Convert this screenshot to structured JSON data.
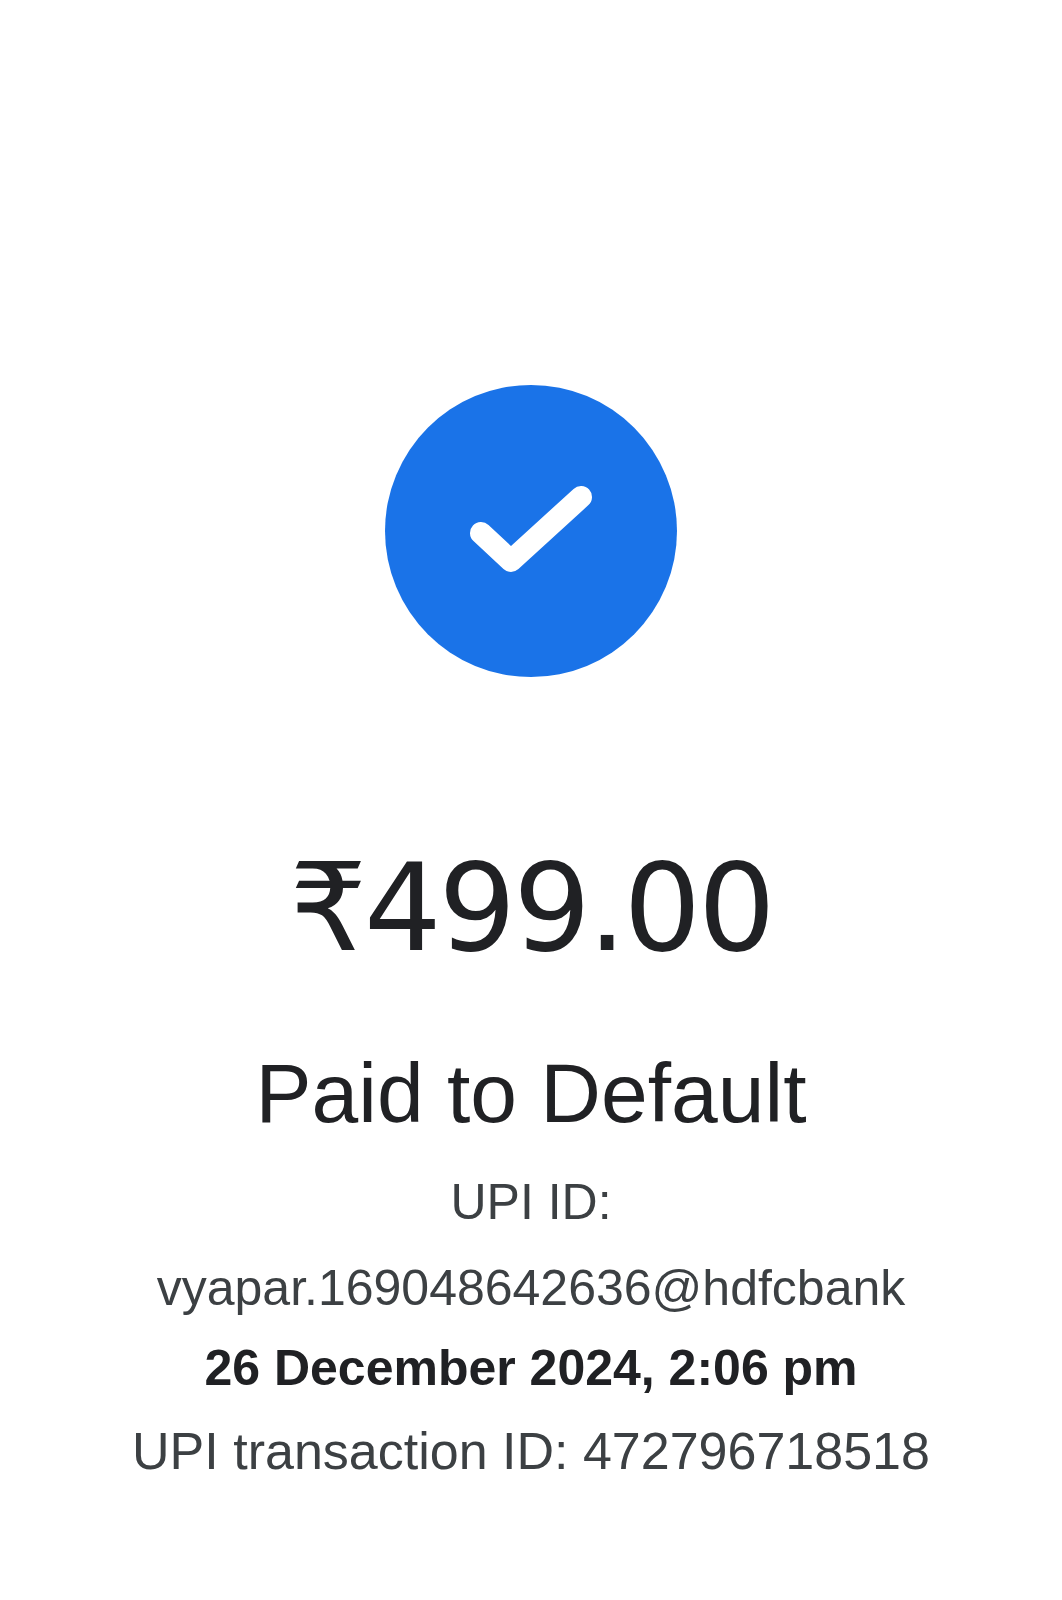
{
  "amount": "₹499.00",
  "payee": "Paid to Default",
  "upi_id": "UPI ID: vyapar.169048642636@hdfcbank",
  "datetime": "26 December 2024, 2:06 pm",
  "transaction_id": "UPI transaction ID: 472796718518"
}
